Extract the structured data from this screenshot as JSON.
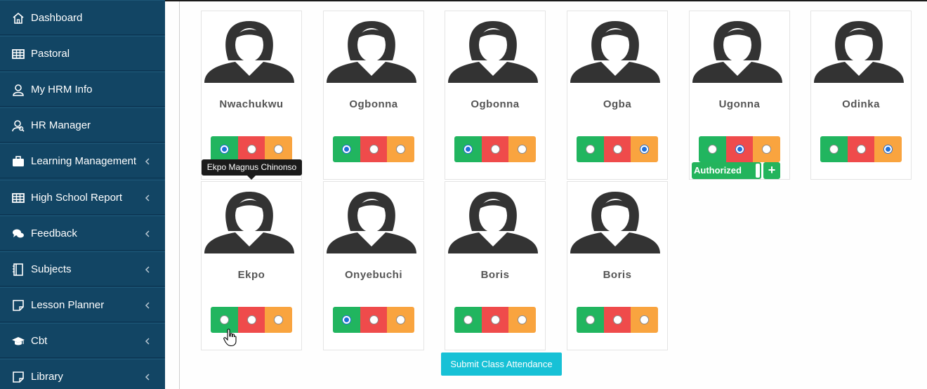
{
  "sidebar": {
    "items": [
      {
        "label": "Dashboard",
        "icon": "home-icon"
      },
      {
        "label": "Pastoral",
        "icon": "table-icon"
      },
      {
        "label": "My HRM Info",
        "icon": "user-icon"
      },
      {
        "label": "HR Manager",
        "icon": "user-search-icon"
      },
      {
        "label": "Learning Management",
        "icon": "briefcase-icon"
      },
      {
        "label": "High School Report",
        "icon": "table-icon"
      },
      {
        "label": "Feedback",
        "icon": "comments-icon"
      },
      {
        "label": "Subjects",
        "icon": "notebook-icon"
      },
      {
        "label": "Lesson Planner",
        "icon": "note-icon"
      },
      {
        "label": "Cbt",
        "icon": "graduation-cap-icon"
      },
      {
        "label": "Library",
        "icon": "note-icon"
      }
    ]
  },
  "students": [
    {
      "name": "Nwachukwu",
      "selected": "present"
    },
    {
      "name": "Ogbonna",
      "selected": "present"
    },
    {
      "name": "Ogbonna",
      "selected": "present"
    },
    {
      "name": "Ogba",
      "selected": "late"
    },
    {
      "name": "Ugonna",
      "selected": "absent"
    },
    {
      "name": "Odinka",
      "selected": "late"
    },
    {
      "name": "Ekpo",
      "selected": "none"
    },
    {
      "name": "Onyebuchi",
      "selected": "present"
    },
    {
      "name": "Boris",
      "selected": "none"
    },
    {
      "name": "Boris",
      "selected": "none"
    }
  ],
  "attendance_colors": {
    "present": "#21b55f",
    "absent": "#ef4b4b",
    "late": "#f9a43f"
  },
  "authorized_label": "Authorized",
  "plus_label": "+",
  "tooltip": "Ekpo Magnus Chinonso",
  "submit_label": "Submit Class Attendance"
}
